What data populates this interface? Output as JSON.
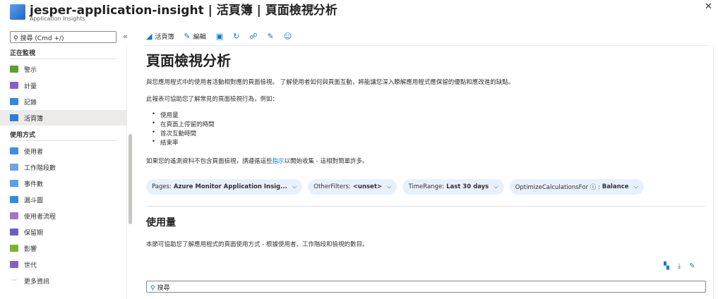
{
  "header": {
    "title": "jesper-application-insight | 活頁簿 | 頁面檢視分析",
    "subtitle": "Application Insights"
  },
  "sidebar": {
    "search_placeholder": "搜尋 (Cmd +/)",
    "sections": [
      {
        "title": "正在監視",
        "items": [
          {
            "label": "警示",
            "icon": "alert-icon",
            "color": "#5c9e31"
          },
          {
            "label": "計量",
            "icon": "metrics-icon",
            "color": "#8661c5"
          },
          {
            "label": "記錄",
            "icon": "logs-icon",
            "color": "#2d8ce0"
          },
          {
            "label": "活頁簿",
            "icon": "workbook-icon",
            "color": "#2d7ce0",
            "selected": true
          }
        ]
      },
      {
        "title": "使用方式",
        "items": [
          {
            "label": "使用者",
            "icon": "users-icon",
            "color": "#3d8fe0"
          },
          {
            "label": "工作階段數",
            "icon": "sessions-icon",
            "color": "#6ea6e0"
          },
          {
            "label": "事件數",
            "icon": "events-icon",
            "color": "#5aa0e8"
          },
          {
            "label": "漏斗圖",
            "icon": "funnel-icon",
            "color": "#2d8ce0"
          },
          {
            "label": "使用者流程",
            "icon": "user-flows-icon",
            "color": "#a675c9"
          },
          {
            "label": "保留期",
            "icon": "retention-icon",
            "color": "#6b5fc4"
          },
          {
            "label": "影響",
            "icon": "impact-icon",
            "color": "#7bb32e"
          },
          {
            "label": "世代",
            "icon": "cohorts-icon",
            "color": "#8c5cc8"
          },
          {
            "label": "更多資訊",
            "icon": "more-icon",
            "color": "#605e5c"
          }
        ]
      }
    ]
  },
  "toolbar": {
    "workbook": "活頁簿",
    "edit": "編輯"
  },
  "main": {
    "title": "頁面檢視分析",
    "intro": "與您應用程式中的使用者活動相對應的頁面檢視。 了解使用者如何與頁面互動，將能讓您深入瞭解應用程式應保留的優點和應改進的缺點。",
    "lead": "此報表可協助您了解常見的頁面檢視行為，例如：",
    "bullets": [
      "使用量",
      "在頁面上停留的時間",
      "首次互動時間",
      "結束率"
    ],
    "note_pre": "如果您的遙測資料不包含頁面檢視，請遵循這些",
    "note_link": "指示",
    "note_post": "以開始收集 - 這相對簡單許多。",
    "filters": [
      {
        "label": "Pages:",
        "value": "Azure Monitor Application Insig..."
      },
      {
        "label": "OtherFilters:",
        "value": "<unset>"
      },
      {
        "label": "TimeRange:",
        "value": "Last 30 days"
      },
      {
        "label": "OptimizeCalculationsFor ⓘ :",
        "value": "Balance"
      }
    ],
    "section_title": "使用量",
    "section_desc": "本節可協助您了解應用程式的頁面使用方式 - 根據使用者、工作階段和檢視的數目。",
    "search_placeholder": "搜尋"
  }
}
